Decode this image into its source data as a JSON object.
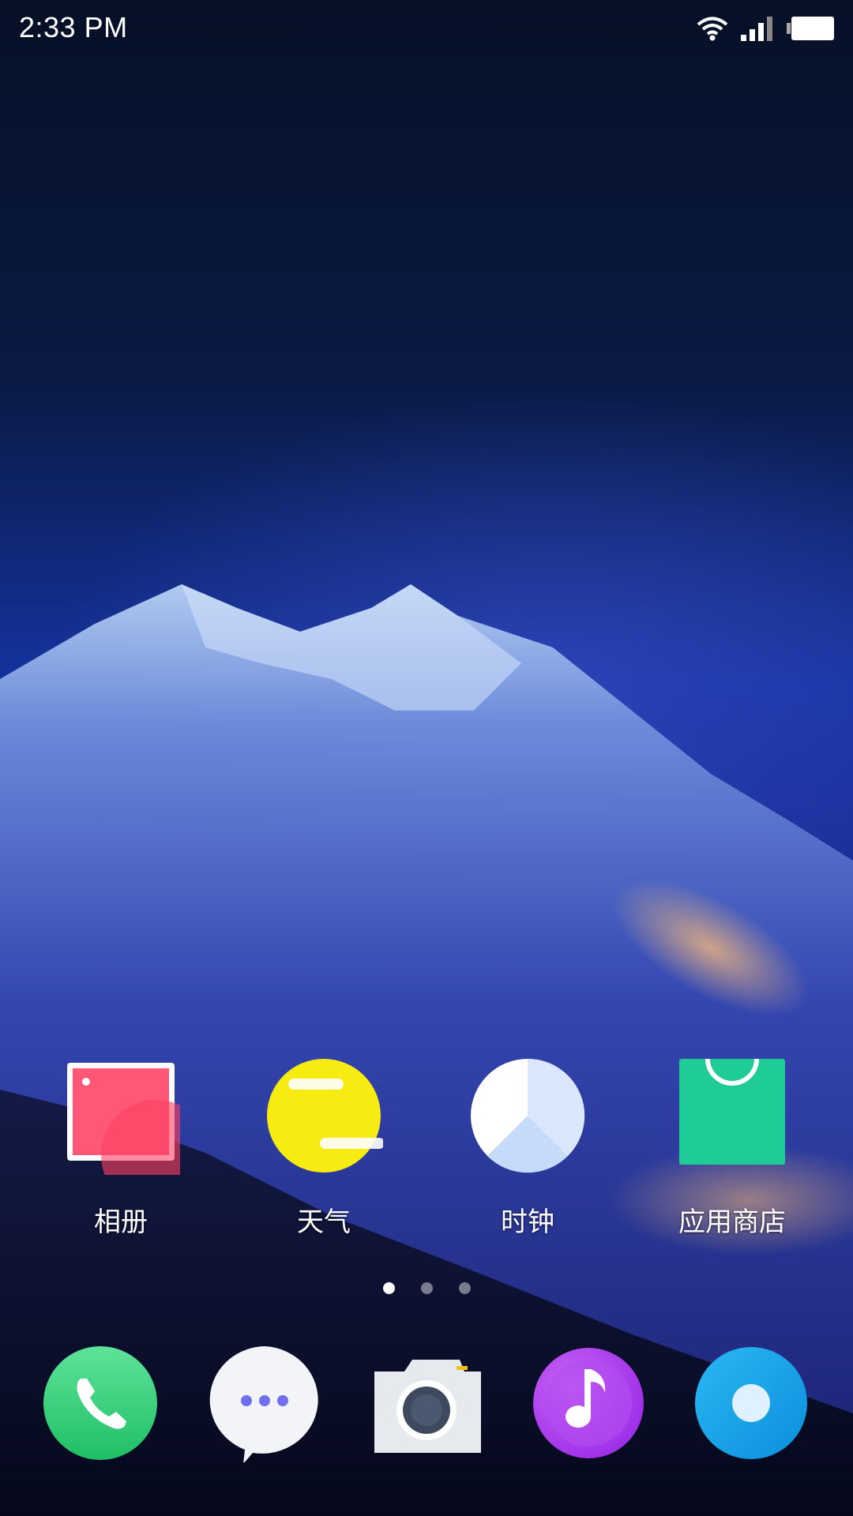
{
  "status_bar": {
    "time": "2:33 PM",
    "icons": [
      "wifi-icon",
      "signal-icon",
      "battery-icon"
    ]
  },
  "home_apps": [
    {
      "label": "相册",
      "icon": "gallery-icon",
      "color": "#ff4a6e"
    },
    {
      "label": "天气",
      "icon": "weather-icon",
      "color": "#f5e30a"
    },
    {
      "label": "时钟",
      "icon": "clock-icon",
      "color": "#dbe8ff"
    },
    {
      "label": "应用商店",
      "icon": "app-store-icon",
      "color": "#1dc793"
    }
  ],
  "page_indicator": {
    "pages": 3,
    "current": 1
  },
  "dock": [
    {
      "icon": "phone-icon",
      "color": "#2fd47a"
    },
    {
      "icon": "messages-icon",
      "color": "#ffffff"
    },
    {
      "icon": "camera-icon",
      "color": "#e6e9ee"
    },
    {
      "icon": "music-icon",
      "color": "#b23cf0"
    },
    {
      "icon": "browser-icon",
      "color": "#1aa7ef"
    }
  ]
}
